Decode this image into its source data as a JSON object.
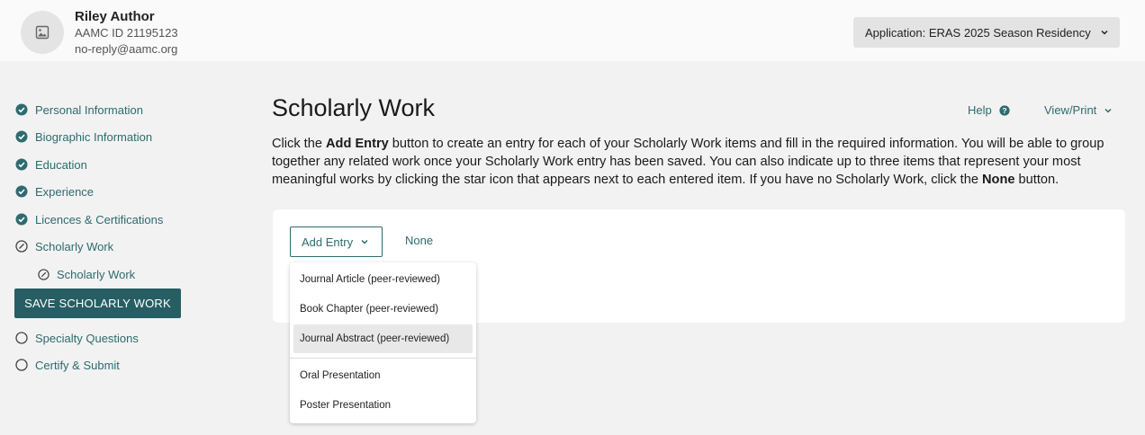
{
  "user": {
    "name": "Riley Author",
    "aamc_id": "AAMC ID 21195123",
    "email": "no-reply@aamc.org",
    "avatar_icon": "image-placeholder-icon"
  },
  "application_select": {
    "label": "Application: ERAS 2025 Season Residency"
  },
  "nav": {
    "items": [
      {
        "label": "Personal Information",
        "status": "complete"
      },
      {
        "label": "Biographic Information",
        "status": "complete"
      },
      {
        "label": "Education",
        "status": "complete"
      },
      {
        "label": "Experience",
        "status": "complete"
      },
      {
        "label": "Licences & Certifications",
        "status": "complete"
      },
      {
        "label": "Scholarly Work",
        "status": "in-progress"
      },
      {
        "label": "Scholarly Work",
        "status": "in-progress"
      },
      {
        "label": "Specialty Questions",
        "status": "incomplete"
      },
      {
        "label": "Certify & Submit",
        "status": "incomplete"
      }
    ],
    "save_button": "SAVE SCHOLARLY WORK"
  },
  "main": {
    "title": "Scholarly Work",
    "help_label": "Help",
    "viewprint_label": "View/Print",
    "intro": {
      "p1": "Click the ",
      "b1": "Add Entry",
      "p2": " button to create an entry for each of your Scholarly Work items and fill in the required information. You will be able to group together any related work once your Scholarly Work entry has been saved. You can also indicate up to three items that represent your most meaningful works by clicking the star icon that appears next to each entered item. If you have no Scholarly Work, click the ",
      "b2": "None",
      "p3": " button."
    },
    "add_entry_label": "Add Entry",
    "none_label": "None",
    "menu": [
      "Journal Article (peer-reviewed)",
      "Book Chapter (peer-reviewed)",
      "Journal Abstract (peer-reviewed)",
      "Oral Presentation",
      "Poster Presentation"
    ],
    "menu_highlighted": "Journal Abstract (peer-reviewed)"
  },
  "colors": {
    "accent": "#2d6b6f",
    "save_button_bg": "#265e63"
  }
}
